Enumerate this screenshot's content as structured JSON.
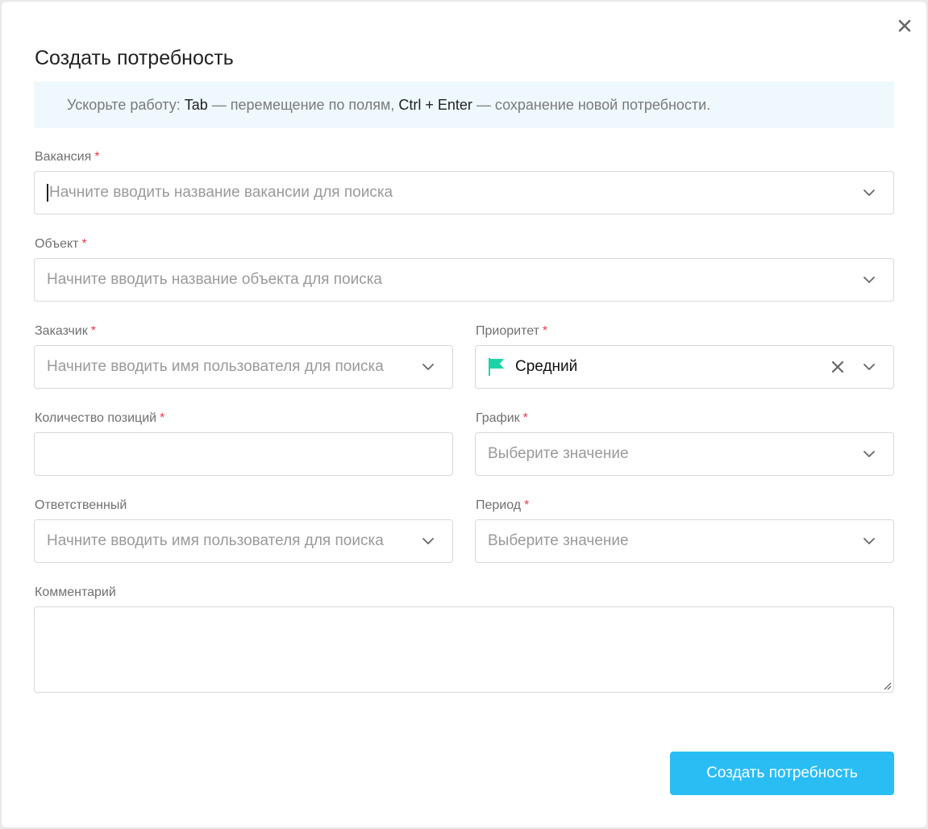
{
  "dialog": {
    "title": "Создать потребность",
    "hint": {
      "prefix": "Ускорьте работу: ",
      "key1": "Tab",
      "middle": " — перемещение по полям, ",
      "key2": "Ctrl + Enter",
      "suffix": " — сохранение новой потребности."
    },
    "fields": {
      "vacancy": {
        "label": "Вакансия",
        "required": "*",
        "placeholder": "Начните вводить название вакансии для поиска"
      },
      "object": {
        "label": "Объект",
        "required": "*",
        "placeholder": "Начните вводить название объекта для поиска"
      },
      "customer": {
        "label": "Заказчик",
        "required": "*",
        "placeholder": "Начните вводить имя пользователя для поиска"
      },
      "priority": {
        "label": "Приоритет",
        "required": "*",
        "value": "Средний",
        "flag_color": "#1fd3a8"
      },
      "positions_count": {
        "label": "Количество позиций",
        "required": "*",
        "value": ""
      },
      "schedule": {
        "label": "График",
        "required": "*",
        "placeholder": "Выберите значение"
      },
      "responsible": {
        "label": "Ответственный",
        "placeholder": "Начните вводить имя пользователя для поиска"
      },
      "period": {
        "label": "Период",
        "required": "*",
        "placeholder": "Выберите значение"
      },
      "comment": {
        "label": "Комментарий",
        "value": ""
      }
    },
    "submit_label": "Создать потребность"
  },
  "colors": {
    "accent": "#29bdf4",
    "required": "#e23e4e",
    "hint_bg": "#eef8fd"
  },
  "icons": {
    "close": "close-icon",
    "dropdown": "chevron-down-icon",
    "clear": "clear-icon",
    "flag": "flag-icon"
  }
}
